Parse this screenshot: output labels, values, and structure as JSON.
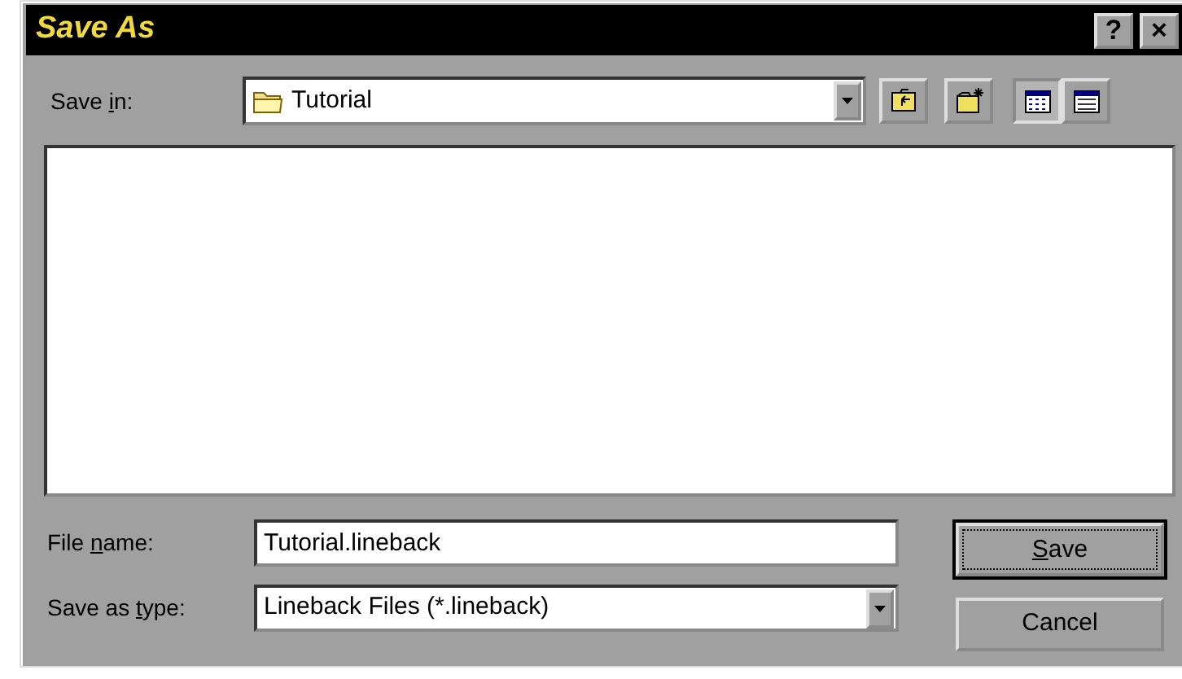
{
  "window": {
    "title": "Save As",
    "title_buttons": [
      "?",
      "×"
    ]
  },
  "save_in": {
    "label_parts": [
      {
        "text": "Save ",
        "underlined": false
      },
      {
        "text": "i",
        "underlined": true
      },
      {
        "text": "n:",
        "underlined": false
      }
    ],
    "value": "Tutorial"
  },
  "toolbar": [
    {
      "kind": "up"
    },
    {
      "kind": "new-folder"
    },
    {
      "kind": "list",
      "selected": true
    },
    {
      "kind": "details",
      "selected": false
    }
  ],
  "file_name": {
    "label_parts": [
      {
        "text": "File ",
        "underlined": false
      },
      {
        "text": "n",
        "underlined": true
      },
      {
        "text": "ame:",
        "underlined": false
      }
    ],
    "value": "Tutorial.lineback"
  },
  "save_as_type": {
    "label_parts": [
      {
        "text": "Save as ",
        "underlined": false
      },
      {
        "text": "t",
        "underlined": true
      },
      {
        "text": "ype:",
        "underlined": false
      }
    ],
    "value": "Lineback Files (*.lineback)"
  },
  "buttons": [
    {
      "label_parts": [
        {
          "text": "S",
          "underlined": true
        },
        {
          "text": "ave",
          "underlined": false
        }
      ],
      "default": true
    },
    {
      "label_parts": [
        {
          "text": "Cancel",
          "underlined": false
        }
      ],
      "default": false
    }
  ]
}
